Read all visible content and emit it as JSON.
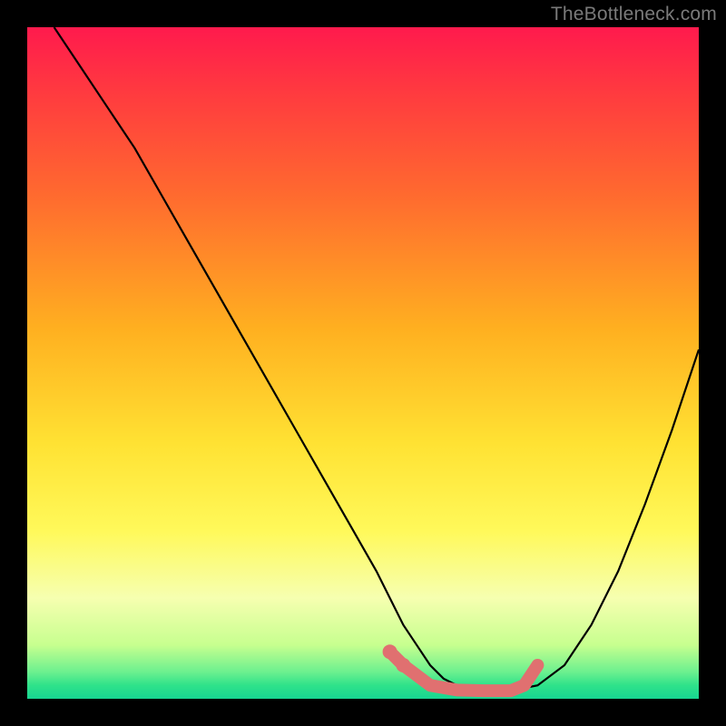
{
  "watermark": "TheBottleneck.com",
  "chart_data": {
    "type": "line",
    "title": "",
    "xlabel": "",
    "ylabel": "",
    "xlim": [
      0,
      100
    ],
    "ylim": [
      0,
      100
    ],
    "series": [
      {
        "name": "bottleneck-curve",
        "x": [
          4,
          8,
          12,
          16,
          20,
          24,
          28,
          32,
          36,
          40,
          44,
          48,
          52,
          54,
          56,
          58,
          60,
          62,
          64,
          66,
          68,
          70,
          72,
          76,
          80,
          84,
          88,
          92,
          96,
          100
        ],
        "y": [
          100,
          94,
          88,
          82,
          75,
          68,
          61,
          54,
          47,
          40,
          33,
          26,
          19,
          15,
          11,
          8,
          5,
          3,
          2,
          1.5,
          1.3,
          1.2,
          1.2,
          2,
          5,
          11,
          19,
          29,
          40,
          52
        ]
      }
    ],
    "highlight_band": {
      "name": "optimal-range",
      "color": "#e07070",
      "x_points": [
        54,
        56,
        60,
        64,
        68,
        72,
        74,
        76
      ],
      "y_points": [
        7,
        5,
        2,
        1.3,
        1.2,
        1.2,
        2,
        5
      ]
    }
  }
}
